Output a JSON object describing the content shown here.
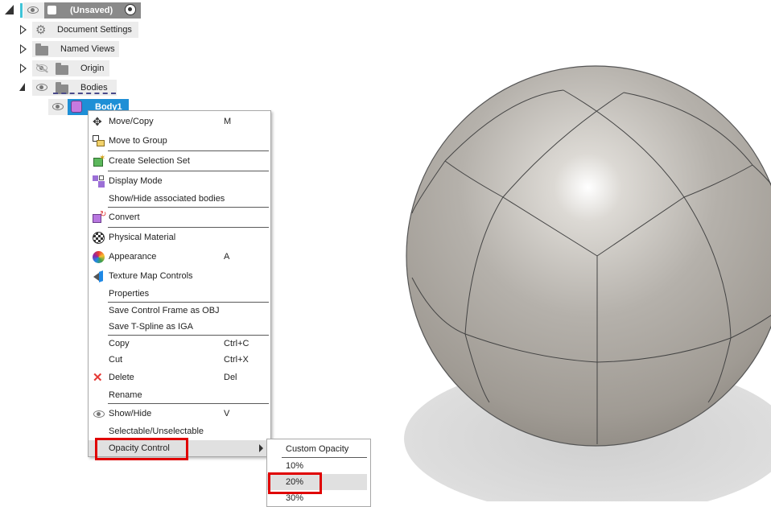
{
  "browser": {
    "root_label": "(Unsaved)",
    "items": [
      {
        "label": "Document Settings"
      },
      {
        "label": "Named Views"
      },
      {
        "label": "Origin"
      },
      {
        "label": "Bodies"
      }
    ],
    "body_item": {
      "label": "Body1"
    }
  },
  "context_menu": {
    "items": [
      {
        "label": "Move/Copy",
        "shortcut": "M",
        "icon": "move-icon"
      },
      {
        "label": "Move to Group",
        "shortcut": "",
        "icon": "move-to-group-icon"
      },
      {
        "label": "Create Selection Set",
        "shortcut": "",
        "icon": "selection-set-icon"
      },
      {
        "label": "Display Mode",
        "shortcut": "",
        "icon": "display-mode-icon"
      },
      {
        "label": "Show/Hide associated bodies",
        "shortcut": ""
      },
      {
        "label": "Convert",
        "shortcut": "",
        "icon": "convert-icon"
      },
      {
        "label": "Physical Material",
        "shortcut": "",
        "icon": "physical-material-icon"
      },
      {
        "label": "Appearance",
        "shortcut": "A",
        "icon": "appearance-icon"
      },
      {
        "label": "Texture Map Controls",
        "shortcut": "",
        "icon": "texture-map-icon"
      },
      {
        "label": "Properties",
        "shortcut": ""
      },
      {
        "label": "Save Control Frame as OBJ",
        "shortcut": ""
      },
      {
        "label": "Save T-Spline as IGA",
        "shortcut": ""
      },
      {
        "label": "Copy",
        "shortcut": "Ctrl+C"
      },
      {
        "label": "Cut",
        "shortcut": "Ctrl+X"
      },
      {
        "label": "Delete",
        "shortcut": "Del",
        "icon": "delete-icon"
      },
      {
        "label": "Rename",
        "shortcut": ""
      },
      {
        "label": "Show/Hide",
        "shortcut": "V",
        "icon": "eye-icon"
      },
      {
        "label": "Selectable/Unselectable",
        "shortcut": ""
      },
      {
        "label": "Opacity Control",
        "shortcut": "",
        "highlighted": true
      }
    ]
  },
  "opacity_submenu": {
    "items": [
      {
        "label": "Custom Opacity"
      },
      {
        "label": "10%"
      },
      {
        "label": "20%",
        "highlighted": true
      },
      {
        "label": "30%"
      }
    ]
  },
  "colors": {
    "accent": "#1e8fd6",
    "highlight_box": "#e00000",
    "menu_hover": "#e0e0e0"
  }
}
